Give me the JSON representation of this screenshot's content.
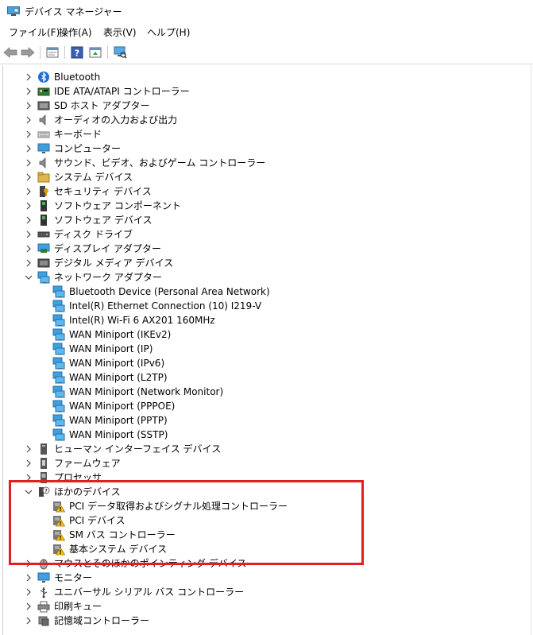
{
  "window": {
    "title": "デバイス マネージャー",
    "highlight_color": "#e02020"
  },
  "menu": [
    {
      "label": "ファイル(F)"
    },
    {
      "label": "操作(A)"
    },
    {
      "label": "表示(V)"
    },
    {
      "label": "ヘルプ(H)"
    }
  ],
  "toolbar": {
    "buttons": [
      "back-icon",
      "forward-icon",
      "properties-icon",
      "help-icon",
      "update-driver-icon",
      "scan-hardware-icon"
    ]
  },
  "tree": [
    {
      "label": "Bluetooth",
      "level": 0,
      "state": "collapsed",
      "icon": "bluetooth"
    },
    {
      "label": "IDE ATA/ATAPI コントローラー",
      "level": 0,
      "state": "collapsed",
      "icon": "ide"
    },
    {
      "label": "SD ホスト アダプター",
      "level": 0,
      "state": "collapsed",
      "icon": "sd"
    },
    {
      "label": "オーディオの入力および出力",
      "level": 0,
      "state": "collapsed",
      "icon": "audio"
    },
    {
      "label": "キーボード",
      "level": 0,
      "state": "collapsed",
      "icon": "keyboard"
    },
    {
      "label": "コンピューター",
      "level": 0,
      "state": "collapsed",
      "icon": "monitor"
    },
    {
      "label": "サウンド、ビデオ、およびゲーム コントローラー",
      "level": 0,
      "state": "collapsed",
      "icon": "audio"
    },
    {
      "label": "システム デバイス",
      "level": 0,
      "state": "collapsed",
      "icon": "folder"
    },
    {
      "label": "セキュリティ デバイス",
      "level": 0,
      "state": "collapsed",
      "icon": "security"
    },
    {
      "label": "ソフトウェア コンポーネント",
      "level": 0,
      "state": "collapsed",
      "icon": "software"
    },
    {
      "label": "ソフトウェア デバイス",
      "level": 0,
      "state": "collapsed",
      "icon": "software"
    },
    {
      "label": "ディスク ドライブ",
      "level": 0,
      "state": "collapsed",
      "icon": "disk"
    },
    {
      "label": "ディスプレイ アダプター",
      "level": 0,
      "state": "collapsed",
      "icon": "display"
    },
    {
      "label": "デジタル メディア デバイス",
      "level": 0,
      "state": "collapsed",
      "icon": "media"
    },
    {
      "label": "ネットワーク アダプター",
      "level": 0,
      "state": "expanded",
      "icon": "network"
    },
    {
      "label": "Bluetooth Device (Personal Area Network)",
      "level": 1,
      "state": "none",
      "icon": "network"
    },
    {
      "label": "Intel(R) Ethernet Connection (10) I219-V",
      "level": 1,
      "state": "none",
      "icon": "network"
    },
    {
      "label": "Intel(R) Wi-Fi 6 AX201 160MHz",
      "level": 1,
      "state": "none",
      "icon": "network"
    },
    {
      "label": "WAN Miniport (IKEv2)",
      "level": 1,
      "state": "none",
      "icon": "network"
    },
    {
      "label": "WAN Miniport (IP)",
      "level": 1,
      "state": "none",
      "icon": "network"
    },
    {
      "label": "WAN Miniport (IPv6)",
      "level": 1,
      "state": "none",
      "icon": "network"
    },
    {
      "label": "WAN Miniport (L2TP)",
      "level": 1,
      "state": "none",
      "icon": "network"
    },
    {
      "label": "WAN Miniport (Network Monitor)",
      "level": 1,
      "state": "none",
      "icon": "network"
    },
    {
      "label": "WAN Miniport (PPPOE)",
      "level": 1,
      "state": "none",
      "icon": "network"
    },
    {
      "label": "WAN Miniport (PPTP)",
      "level": 1,
      "state": "none",
      "icon": "network"
    },
    {
      "label": "WAN Miniport (SSTP)",
      "level": 1,
      "state": "none",
      "icon": "network"
    },
    {
      "label": "ヒューマン インターフェイス デバイス",
      "level": 0,
      "state": "collapsed",
      "icon": "hid"
    },
    {
      "label": "ファームウェア",
      "level": 0,
      "state": "collapsed",
      "icon": "firmware"
    },
    {
      "label": "プロセッサ",
      "level": 0,
      "state": "collapsed",
      "icon": "processor"
    },
    {
      "label": "ほかのデバイス",
      "level": 0,
      "state": "expanded",
      "icon": "unknown"
    },
    {
      "label": "PCI データ取得およびシグナル処理コントローラー",
      "level": 1,
      "state": "none",
      "icon": "warning"
    },
    {
      "label": "PCI デバイス",
      "level": 1,
      "state": "none",
      "icon": "warning"
    },
    {
      "label": "SM バス コントローラー",
      "level": 1,
      "state": "none",
      "icon": "warning"
    },
    {
      "label": "基本システム デバイス",
      "level": 1,
      "state": "none",
      "icon": "warning"
    },
    {
      "label": "マウスとそのほかのポインティング デバイス",
      "level": 0,
      "state": "collapsed",
      "icon": "mouse"
    },
    {
      "label": "モニター",
      "level": 0,
      "state": "collapsed",
      "icon": "monitor"
    },
    {
      "label": "ユニバーサル シリアル バス コントローラー",
      "level": 0,
      "state": "collapsed",
      "icon": "usb"
    },
    {
      "label": "印刷キュー",
      "level": 0,
      "state": "collapsed",
      "icon": "printer"
    },
    {
      "label": "記憶域コントローラー",
      "level": 0,
      "state": "collapsed",
      "icon": "storage"
    }
  ]
}
